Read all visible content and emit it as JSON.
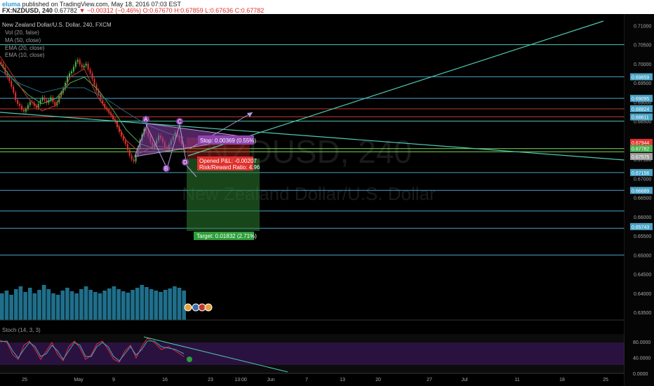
{
  "header": {
    "logo_text": "eluma",
    "published_text": "published on TradingView.com, May 18, 2016 07:03 EST",
    "symbol_text": "FX:NZDUSD, 240",
    "price_text": "0.67782",
    "change_text": "▼ −0.00312 (−0.46%)",
    "ohlc_text": "O:0.67670 H:0.67859 L:0.67636 C:0.67782"
  },
  "chart_data": {
    "type": "line",
    "title": "New Zealand Dollar/U.S. Dollar, 240, FXCM",
    "indicators": [
      "Vol (20, false)",
      "MA (50, close)",
      "EMA (20, close)",
      "EMA (10, close)"
    ],
    "watermark_symbol": "NZDUSD, 240",
    "watermark_name": "New Zealand Dollar/U.S. Dollar",
    "y_ticks": [
      0.71,
      0.705,
      0.7,
      0.695,
      0.69,
      0.685,
      0.68,
      0.675,
      0.67,
      0.665,
      0.66,
      0.655,
      0.65,
      0.645,
      0.64,
      0.635
    ],
    "ylim": [
      0.633,
      0.713
    ],
    "price_labels": [
      {
        "value": 0.69659,
        "text": "0.69659",
        "color": "#4aa3c7"
      },
      {
        "value": 0.69095,
        "text": "0.69095",
        "color": "#4aa3c7"
      },
      {
        "value": 0.68824,
        "text": "0.68824",
        "color": "#4aa3c7"
      },
      {
        "value": 0.68611,
        "text": "0.68611",
        "color": "#4aa3c7"
      },
      {
        "value": 0.67944,
        "text": "0.67944",
        "color": "#e0312d"
      },
      {
        "value": 0.67782,
        "text": "0.67782",
        "color": "#4caf50"
      },
      {
        "value": 0.67575,
        "text": "0.67575",
        "color": "#9e9e9e"
      },
      {
        "value": 0.67156,
        "text": "0.67156",
        "color": "#4aa3c7"
      },
      {
        "value": 0.66689,
        "text": "0.66689",
        "color": "#4aa3c7"
      },
      {
        "value": 0.65743,
        "text": "0.65743",
        "color": "#4aa3c7"
      }
    ],
    "horizontal_levels": [
      {
        "value": 0.705,
        "color": "#4ec9b0"
      },
      {
        "value": 0.69659,
        "color": "#4aa3c7"
      },
      {
        "value": 0.69095,
        "color": "#4aa3c7"
      },
      {
        "value": 0.68824,
        "color": "#c0392b"
      },
      {
        "value": 0.68611,
        "color": "#c0392b"
      },
      {
        "value": 0.685,
        "color": "#4ec9b0"
      },
      {
        "value": 0.67782,
        "color": "#7ed957"
      },
      {
        "value": 0.677,
        "color": "#7ed957"
      },
      {
        "value": 0.67156,
        "color": "#4aa3c7"
      },
      {
        "value": 0.66689,
        "color": "#4aa3c7"
      },
      {
        "value": 0.6615,
        "color": "#4aa3c7"
      },
      {
        "value": 0.657,
        "color": "#4aa3c7"
      },
      {
        "value": 0.65,
        "color": "#4aa3c7"
      }
    ],
    "x_ticks": [
      "25",
      "May",
      "9",
      "16",
      "23",
      "13:00",
      "Jun",
      "7",
      "13",
      "20",
      "27",
      "Jul",
      "11",
      "18",
      "25"
    ],
    "pattern_labels": [
      "A",
      "B",
      "C",
      "D"
    ],
    "stop_label": "Stop: 0.00369 (0.55%)",
    "pnl_label": "Opened P&L: -0.00207",
    "rr_label": "Risk/Reward Ratio: 4.96",
    "target_label": "Target: 0.01832 (2.71%)",
    "stoch": {
      "title": "Stoch (14, 3, 3)",
      "y_ticks": [
        "80.0000",
        "40.0000",
        "0.0000"
      ],
      "ylim": [
        0,
        100
      ],
      "upper_band": 80,
      "lower_band": 20
    },
    "colors": {
      "up_candle": "#4caf50",
      "down_candle": "#e0312d",
      "trend_line": "#4ec9b0",
      "triangle_fill": "#8e44ad",
      "target_fill": "#2e7d32",
      "stop_fill": "#b71c1c",
      "volume": "#1f6f8b",
      "stoch_k": "#e0312d",
      "stoch_d": "#4aa3c7"
    }
  }
}
